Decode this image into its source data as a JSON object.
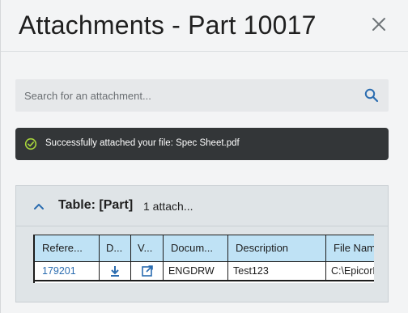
{
  "header": {
    "title": "Attachments - Part 10017",
    "close_icon": "close-icon"
  },
  "search": {
    "placeholder": "Search for an attachment...",
    "value": ""
  },
  "toast": {
    "message": "Successfully attached your file: Spec Sheet.pdf",
    "status_color": "#a8d63b"
  },
  "group": {
    "title": "Table: [Part]",
    "count": "1 attach..."
  },
  "table": {
    "columns": [
      "Refere...",
      "D...",
      "V...",
      "Docum...",
      "Description",
      "File Nam"
    ],
    "rows": [
      {
        "reference": "179201",
        "download_icon": "download-icon",
        "view_icon": "open-external-icon",
        "document_type": "ENGDRW",
        "description": "Test123",
        "file_name": "C:\\EpicorD"
      }
    ]
  },
  "colors": {
    "accent": "#2a6cb0",
    "header_bg": "#bfe2f5",
    "toast_bg": "#333638"
  }
}
